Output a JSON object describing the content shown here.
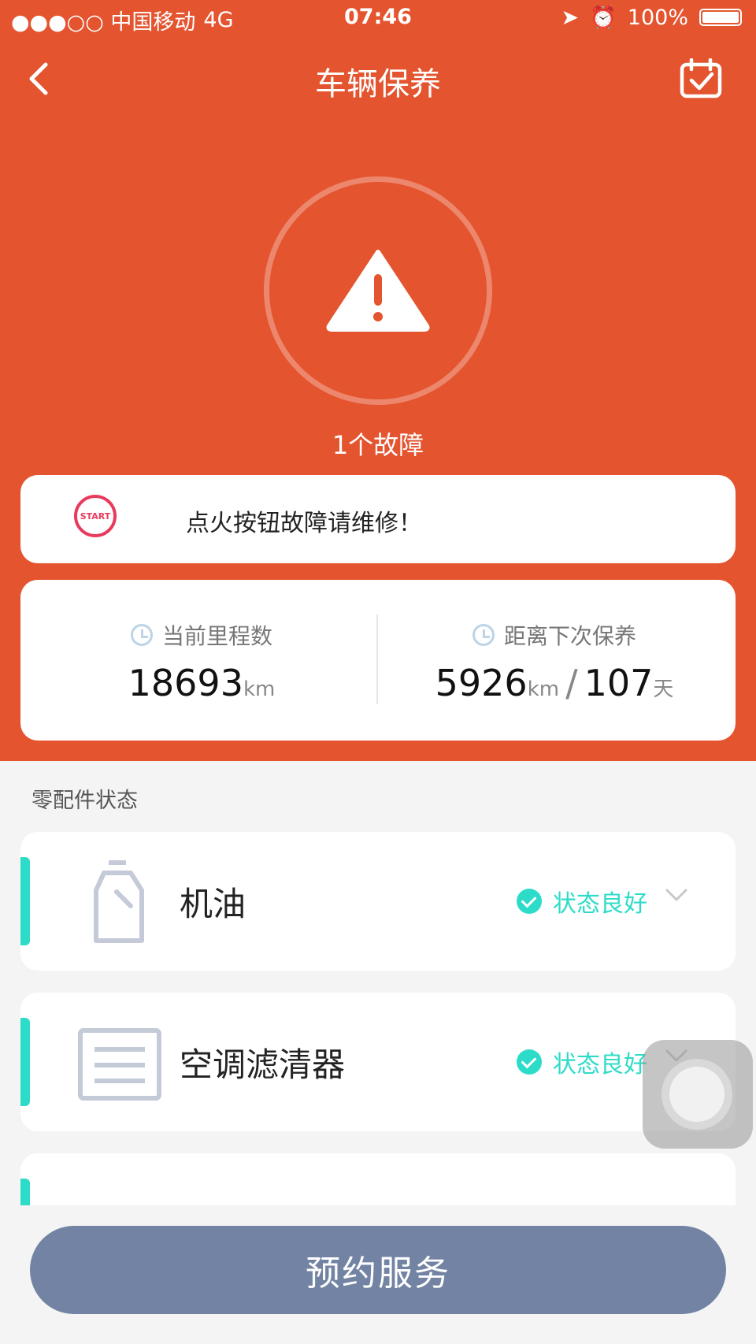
{
  "status_bar": {
    "carrier": "●●●○○ 中国移动",
    "network": "4G",
    "time": "07:46",
    "battery": "100%"
  },
  "header": {
    "title": "车辆保养"
  },
  "fault": {
    "count_text": "1个故障"
  },
  "alert": {
    "logo_text": "START",
    "message": "点火按钮故障请维修！"
  },
  "mileage": {
    "current_label": "当前里程数",
    "current_value": "18693",
    "current_unit": "km",
    "next_label": "距离下次保养",
    "next_km": "5926",
    "next_km_unit": "km",
    "separator": "/",
    "next_days": "107",
    "next_days_unit": "天"
  },
  "parts": {
    "section_title": "零配件状态",
    "items": [
      {
        "name": "机油",
        "status": "状态良好"
      },
      {
        "name": "空调滤清器",
        "status": "状态良好"
      }
    ]
  },
  "footer": {
    "book_button": "预约服务"
  },
  "colors": {
    "primary": "#e4542f",
    "accent": "#2ddcc8",
    "button": "#7283a3"
  }
}
